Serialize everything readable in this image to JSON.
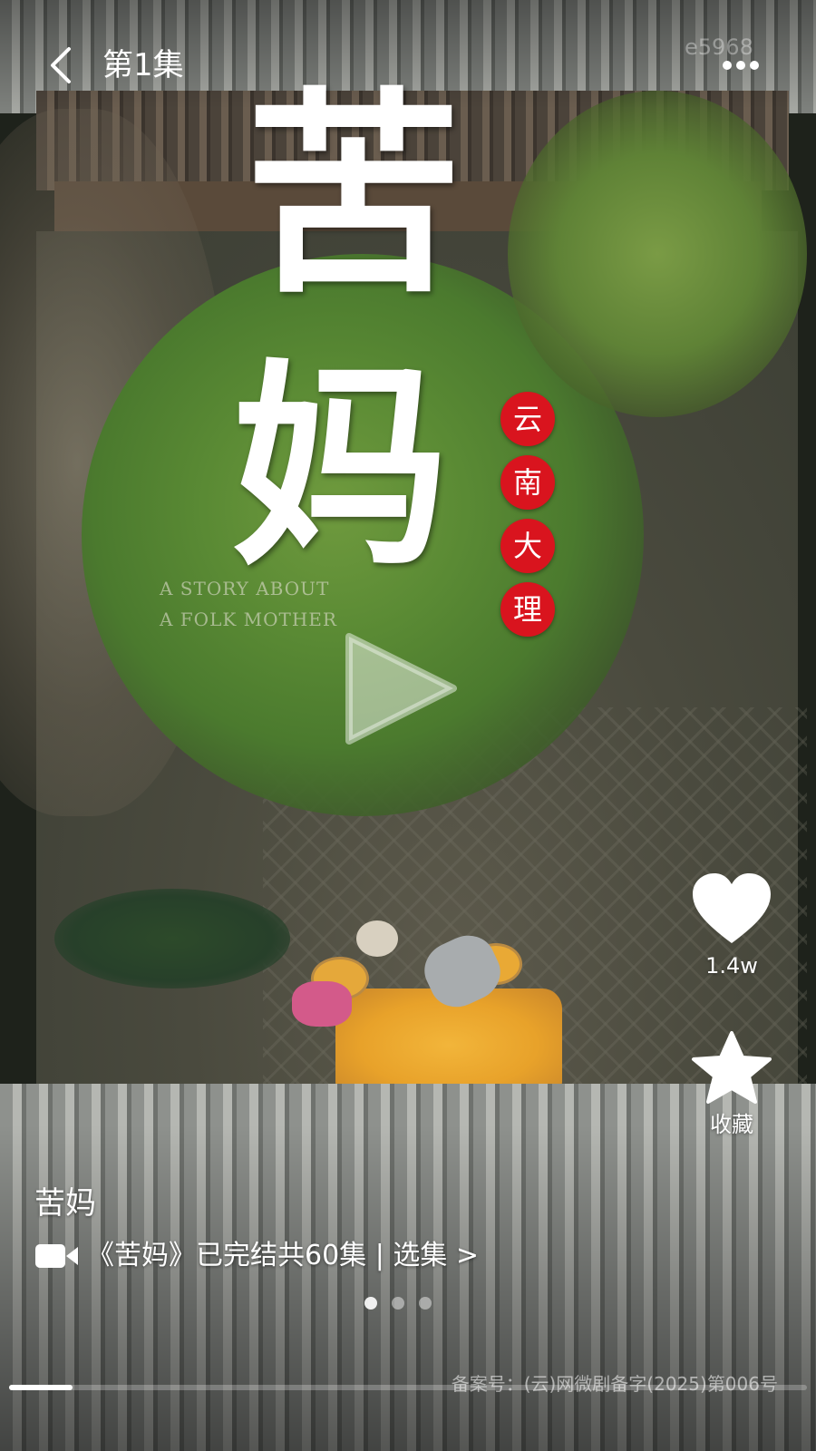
{
  "header": {
    "episode_title": "第1集",
    "watermark_id": "e5968"
  },
  "poster": {
    "title_char_1": "苦",
    "title_char_2": "妈",
    "seal_chars": [
      "云",
      "南",
      "大",
      "理"
    ],
    "english_line_1": "A STORY ABOUT",
    "english_line_2": "A FOLK MOTHER"
  },
  "actions": {
    "like_count": "1.4w",
    "favorite_label": "收藏"
  },
  "info": {
    "drama_title": "苦妈",
    "series_text": "《苦妈》已完结共60集 | 选集 >"
  },
  "pager": {
    "count": 3,
    "active_index": 0
  },
  "progress": {
    "fraction": 0.08
  },
  "footer": {
    "record_number": "备案号：(云)网微剧备字(2025)第006号"
  },
  "icons": {
    "back": "chevron-left-icon",
    "more": "more-dots-icon",
    "play": "play-icon",
    "like": "heart-icon",
    "favorite": "star-icon",
    "series": "video-camera-icon"
  },
  "colors": {
    "seal_red": "#d9141e",
    "text": "#ffffff"
  }
}
